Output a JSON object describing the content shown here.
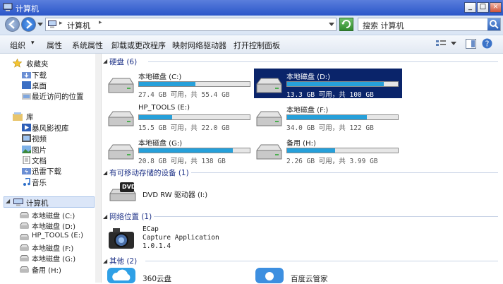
{
  "window": {
    "title": "计算机",
    "btn_min": "_",
    "btn_max": "□",
    "btn_close": "×"
  },
  "addressbar": {
    "path": "计算机",
    "sep": "▸",
    "search_placeholder": "搜索 计算机"
  },
  "toolbar": {
    "items": [
      "组织",
      "属性",
      "系统属性",
      "卸载或更改程序",
      "映射网络驱动器",
      "打开控制面板"
    ],
    "organize_arrow": "▾"
  },
  "nav": {
    "favorites": {
      "label": "收藏夹",
      "items": [
        "下载",
        "桌面",
        "最近访问的位置"
      ]
    },
    "libraries": {
      "label": "库",
      "items": [
        "暴风影视库",
        "视频",
        "图片",
        "文档",
        "迅雷下载",
        "音乐"
      ]
    },
    "computer": {
      "label": "计算机",
      "items": [
        "本地磁盘 (C:)",
        "本地磁盘 (D:)",
        "HP_TOOLS (E:)",
        "本地磁盘 (F:)",
        "本地磁盘 (G:)",
        "备用 (H:)"
      ]
    }
  },
  "groups": {
    "hdd": "硬盘 (6)",
    "removable": "有可移动存储的设备 (1)",
    "network": "网络位置 (1)",
    "other": "其他 (2)"
  },
  "drives": [
    {
      "name": "本地磁盘 (C:)",
      "info": "27.4 GB 可用，共 55.4 GB",
      "used_fraction": 0.51
    },
    {
      "name": "本地磁盘 (D:)",
      "info": "13.3 GB 可用，共 100 GB",
      "used_fraction": 0.87
    },
    {
      "name": "HP_TOOLS (E:)",
      "info": "15.5 GB 可用，共 22.0 GB",
      "used_fraction": 0.3
    },
    {
      "name": "本地磁盘 (F:)",
      "info": "34.0 GB 可用，共 122 GB",
      "used_fraction": 0.72
    },
    {
      "name": "本地磁盘 (G:)",
      "info": "20.8 GB 可用，共 138 GB",
      "used_fraction": 0.85
    },
    {
      "name": "备用 (H:)",
      "info": "2.26 GB 可用，共 3.99 GB",
      "used_fraction": 0.43
    }
  ],
  "removable": {
    "name": "DVD RW 驱动器 (I:)",
    "badge": "DVD"
  },
  "network_loc": {
    "line1": "ECap",
    "line2": "Capture Application",
    "line3": "1.0.1.4"
  },
  "other": [
    "360云盘",
    "百度云管家"
  ],
  "colors": {
    "accent": "#26a0da",
    "selection": "#0a246a",
    "titlebar": "#2a56c9"
  }
}
